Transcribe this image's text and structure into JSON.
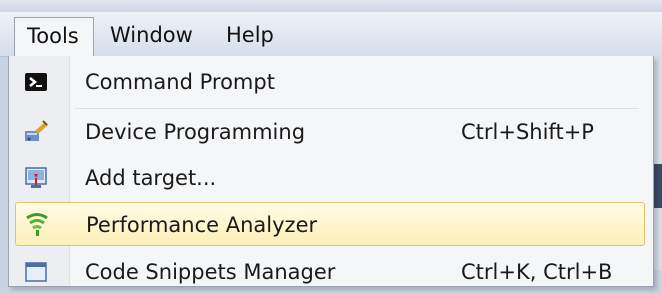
{
  "menubar": {
    "items": [
      {
        "label": "Tools",
        "open": true
      },
      {
        "label": "Window"
      },
      {
        "label": "Help"
      }
    ]
  },
  "dropdown": {
    "items": [
      {
        "label": "Command Prompt",
        "shortcut": "",
        "icon": "terminal-icon"
      },
      {
        "label": "Device Programming",
        "shortcut": "Ctrl+Shift+P",
        "icon": "device-programming-icon"
      },
      {
        "label": "Add target...",
        "shortcut": "",
        "icon": "add-target-icon"
      },
      {
        "label": "Performance Analyzer",
        "shortcut": "",
        "icon": "signal-icon",
        "highlighted": true
      },
      {
        "label": "Code Snippets Manager",
        "shortcut": "Ctrl+K, Ctrl+B",
        "icon": "snippets-icon"
      }
    ]
  },
  "colors": {
    "highlight_fill": "#fdf0b8",
    "highlight_border": "#e5c365",
    "signal_green": "#3f9a2a"
  }
}
